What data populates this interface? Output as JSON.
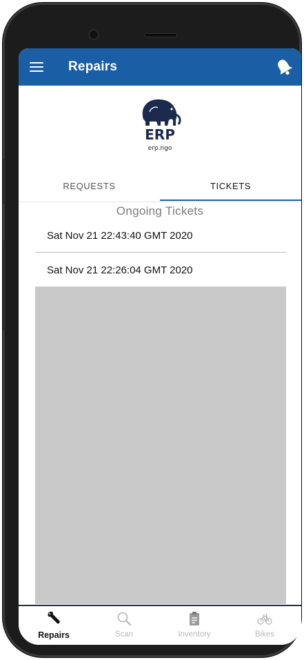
{
  "app_bar": {
    "title": "Repairs",
    "menu_icon": "hamburger-menu-icon",
    "notification_icon": "bell-icon",
    "color": "#1a5ea6"
  },
  "logo": {
    "caption": "erp.ngo"
  },
  "tabs": [
    {
      "label": "REQUESTS",
      "selected": false
    },
    {
      "label": "TICKETS",
      "selected": true
    }
  ],
  "section_title": "Ongoing Tickets",
  "tickets": [
    "Sat Nov 21 22:43:40 GMT 2020",
    "Sat Nov 21 22:26:04 GMT 2020"
  ],
  "bottom_nav": [
    {
      "label": "Repairs",
      "icon": "wrench-icon",
      "active": true
    },
    {
      "label": "Scan",
      "icon": "magnifier-icon",
      "active": false
    },
    {
      "label": "Inventory",
      "icon": "clipboard-icon",
      "active": false
    },
    {
      "label": "Bikes",
      "icon": "bicycle-icon",
      "active": false
    }
  ]
}
